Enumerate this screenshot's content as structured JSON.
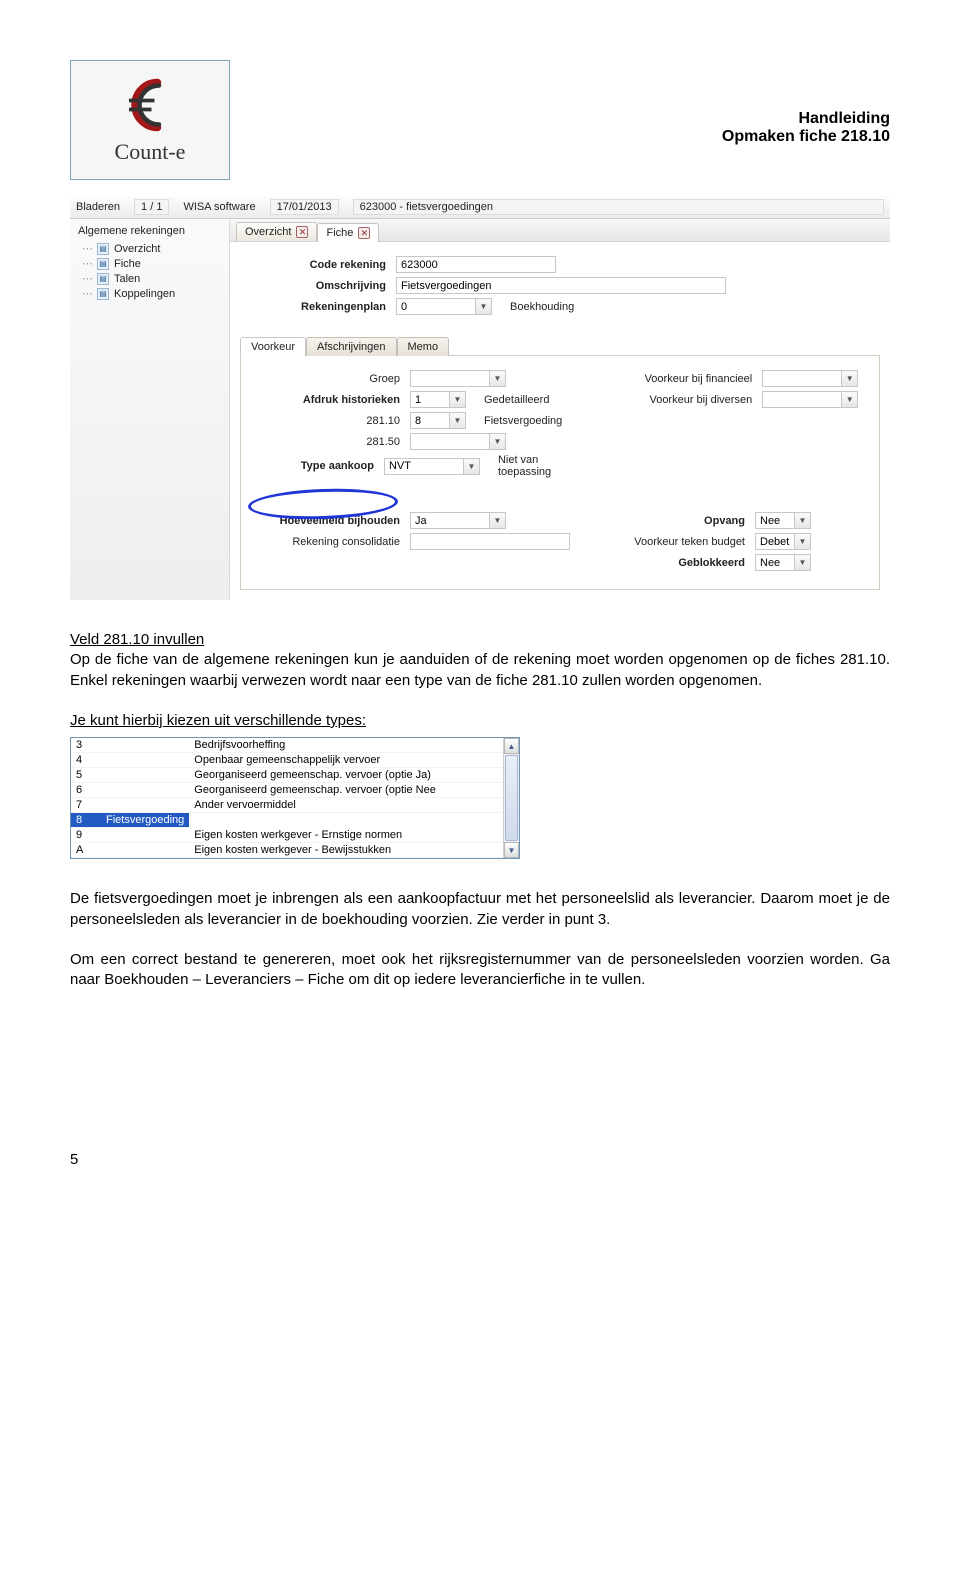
{
  "header": {
    "logo_text": "Count-e",
    "title1": "Handleiding",
    "title2": "Opmaken fiche 218.10"
  },
  "ss1": {
    "topbar": {
      "bladeren": "Bladeren",
      "pager": "1 / 1",
      "source": "WISA software",
      "date": "17/01/2013",
      "crumb": "623000 - fietsvergoedingen"
    },
    "sidebar": {
      "title": "Algemene rekeningen",
      "items": [
        "Overzicht",
        "Fiche",
        "Talen",
        "Koppelingen"
      ]
    },
    "tabs": [
      "Overzicht",
      "Fiche"
    ],
    "form1": {
      "code_lbl": "Code rekening",
      "code_val": "623000",
      "oms_lbl": "Omschrijving",
      "oms_val": "Fietsvergoedingen",
      "plan_lbl": "Rekeningenplan",
      "plan_val": "0",
      "plan_extra": "Boekhouding"
    },
    "subtabs": [
      "Voorkeur",
      "Afschrijvingen",
      "Memo"
    ],
    "leftcol": {
      "groep_lbl": "Groep",
      "groep_val": "",
      "hist_lbl": "Afdruk historieken",
      "hist_val": "1",
      "hist_extra": "Gedetailleerd",
      "r28110_lbl": "281.10",
      "r28110_val": "8",
      "r28110_extra": "Fietsvergoeding",
      "r28150_lbl": "281.50",
      "r28150_val": "",
      "type_lbl": "Type aankoop",
      "type_val": "NVT",
      "type_extra": "Niet van toepassing",
      "hvb_lbl": "Hoeveelheid bijhouden",
      "hvb_val": "Ja",
      "rekcons_lbl": "Rekening consolidatie",
      "rekcons_val": ""
    },
    "rightcol": {
      "vbf_lbl": "Voorkeur bij financieel",
      "vbf_val": "",
      "vbd_lbl": "Voorkeur bij diversen",
      "vbd_val": "",
      "opv_lbl": "Opvang",
      "opv_val": "Nee",
      "vtb_lbl": "Voorkeur teken budget",
      "vtb_val": "Debet",
      "geb_lbl": "Geblokkeerd",
      "geb_val": "Nee"
    }
  },
  "text": {
    "p1a": "Veld 281.10 invullen",
    "p1b": "Op de fiche van de algemene rekeningen kun je aanduiden of de rekening moet worden opgenomen op de fiches 281.10. Enkel rekeningen waarbij verwezen wordt naar een type van de fiche 281.10 zullen worden opgenomen.",
    "p1c": "Je kunt hierbij kiezen uit verschillende types:",
    "p2": "De fietsvergoedingen moet je inbrengen als een aankoopfactuur met het personeelslid als leverancier. Daarom moet je de personeelsleden als leverancier in de boekhouding voorzien. Zie verder in punt 3.",
    "p3": "Om een correct bestand te genereren, moet ook het rijksregisternummer van de personeelsleden voorzien worden. Ga naar Boekhouden – Leveranciers – Fiche om dit op iedere leverancierfiche in te vullen."
  },
  "listbox": {
    "rows": [
      {
        "code": "3",
        "label": "Bedrijfsvoorheffing"
      },
      {
        "code": "4",
        "label": "Openbaar gemeenschappelijk vervoer"
      },
      {
        "code": "5",
        "label": "Georganiseerd gemeenschap. vervoer (optie Ja)"
      },
      {
        "code": "6",
        "label": "Georganiseerd gemeenschap. vervoer (optie Nee"
      },
      {
        "code": "7",
        "label": "Ander vervoermiddel"
      },
      {
        "code": "8",
        "label": "Fietsvergoeding"
      },
      {
        "code": "9",
        "label": "Eigen kosten werkgever - Ernstige normen"
      },
      {
        "code": "A",
        "label": "Eigen kosten werkgever - Bewijsstukken"
      }
    ],
    "selected_index": 5
  },
  "page_number": "5"
}
